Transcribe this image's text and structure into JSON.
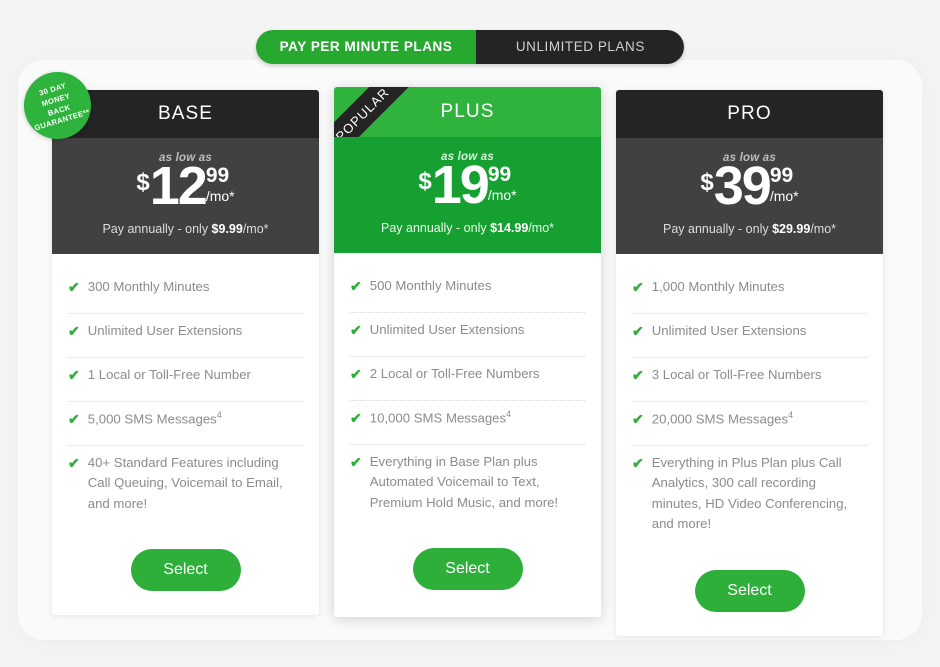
{
  "toggle": {
    "active_tab": "PAY PER MINUTE PLANS",
    "inactive_tab": "UNLIMITED PLANS"
  },
  "badge": {
    "line1": "30 DAY",
    "line2": "MONEY",
    "line3": "BACK",
    "line4": "GUARANTEE**"
  },
  "colors": {
    "brand_green": "#2eaf3a",
    "header_dark": "#242424",
    "price_panel_dark": "#414141",
    "featured_head": "#2eb33c",
    "featured_body": "#17a032",
    "page_bg": "#f4f4f4"
  },
  "plans": [
    {
      "name": "BASE",
      "featured": false,
      "ribbon": "",
      "as_low_as": "as low as",
      "currency": "$",
      "amount": "12",
      "cents": "99",
      "per": "/mo*",
      "annual_prefix": "Pay annually - only ",
      "annual_price": "$9.99",
      "annual_suffix": "/mo*",
      "features": [
        "300 Monthly Minutes",
        "Unlimited User Extensions",
        "1 Local or Toll-Free Number",
        "5,000 SMS Messages",
        "40+ Standard Features including Call Queuing, Voicemail to Email, and more!"
      ],
      "feature_sup": [
        "",
        "",
        "",
        "4",
        ""
      ],
      "select_label": "Select"
    },
    {
      "name": "PLUS",
      "featured": true,
      "ribbon": "POPULAR",
      "as_low_as": "as low as",
      "currency": "$",
      "amount": "19",
      "cents": "99",
      "per": "/mo*",
      "annual_prefix": "Pay annually - only ",
      "annual_price": "$14.99",
      "annual_suffix": "/mo*",
      "features": [
        "500 Monthly Minutes",
        "Unlimited User Extensions",
        "2 Local or Toll-Free Numbers",
        "10,000 SMS Messages",
        "Everything in Base Plan plus Automated Voicemail to Text, Premium Hold Music, and more!"
      ],
      "feature_sup": [
        "",
        "",
        "",
        "4",
        ""
      ],
      "select_label": "Select"
    },
    {
      "name": "PRO",
      "featured": false,
      "ribbon": "",
      "as_low_as": "as low as",
      "currency": "$",
      "amount": "39",
      "cents": "99",
      "per": "/mo*",
      "annual_prefix": "Pay annually - only ",
      "annual_price": "$29.99",
      "annual_suffix": "/mo*",
      "features": [
        "1,000 Monthly Minutes",
        "Unlimited User Extensions",
        "3 Local or Toll-Free Numbers",
        "20,000 SMS Messages",
        "Everything in Plus Plan plus Call Analytics, 300 call recording minutes, HD Video Conferencing, and more!"
      ],
      "feature_sup": [
        "",
        "",
        "",
        "4",
        ""
      ],
      "select_label": "Select"
    }
  ]
}
